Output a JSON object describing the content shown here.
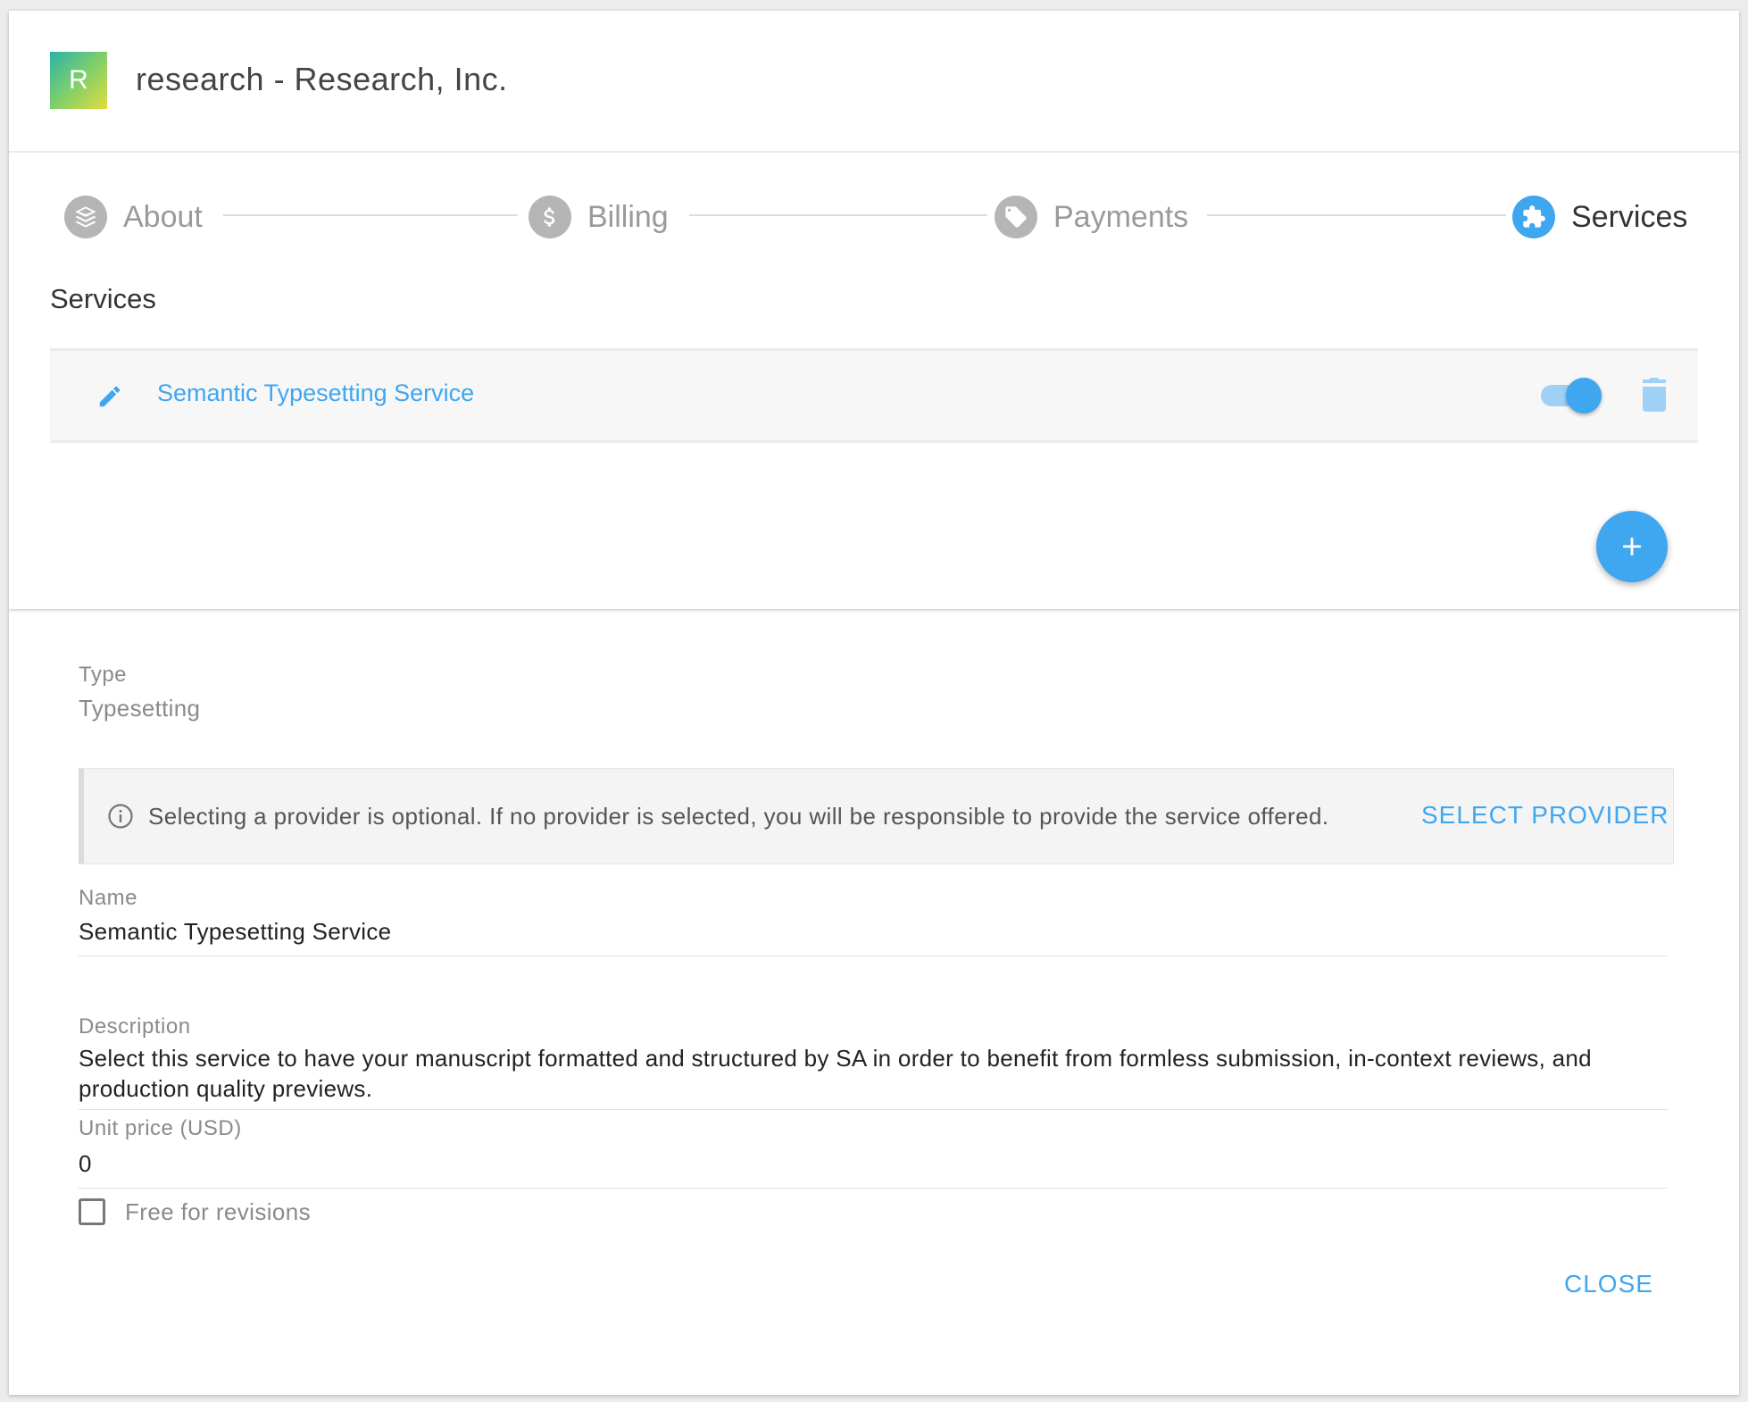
{
  "header": {
    "logo_letter": "R",
    "title": "research - Research, Inc."
  },
  "stepper": {
    "steps": [
      {
        "label": "About",
        "icon": "layers-icon",
        "active": false
      },
      {
        "label": "Billing",
        "icon": "dollar-icon",
        "active": false
      },
      {
        "label": "Payments",
        "icon": "price-tag-icon",
        "active": false
      },
      {
        "label": "Services",
        "icon": "puzzle-icon",
        "active": true
      }
    ]
  },
  "services": {
    "section_title": "Services",
    "items": [
      {
        "name": "Semantic Typesetting Service",
        "enabled": true
      }
    ]
  },
  "detail": {
    "type_label": "Type",
    "type_value": "Typesetting",
    "info_text": "Selecting a provider is optional. If no provider is selected, you will be responsible to provide the service offered.",
    "select_provider_label": "SELECT PROVIDER",
    "name_label": "Name",
    "name_value": "Semantic Typesetting Service",
    "description_label": "Description",
    "description_value": "Select this service to have your manuscript formatted and structured by SA in order to benefit from formless submission, in-context reviews, and production quality previews.",
    "unit_price_label": "Unit price (USD)",
    "unit_price_value": "0",
    "free_for_revisions_label": "Free for revisions",
    "free_for_revisions_checked": false,
    "close_label": "CLOSE"
  },
  "colors": {
    "accent": "#3fa6f0",
    "inactive_step": "#b5b5b5"
  }
}
